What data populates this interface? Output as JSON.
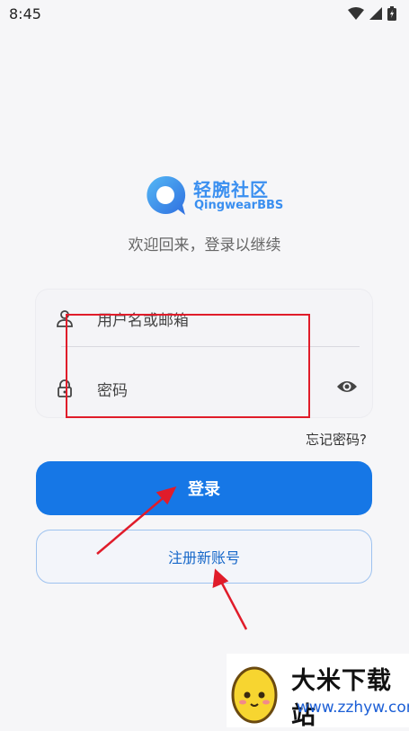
{
  "status": {
    "time": "8:45"
  },
  "app": {
    "logo_title": "轻腕社区",
    "logo_sub": "QingwearBBS",
    "subtitle": "欢迎回来，登录以继续"
  },
  "form": {
    "username_placeholder": "用户名或邮箱",
    "password_placeholder": "密码",
    "forgot_label": "忘记密码?",
    "login_label": "登录",
    "register_label": "注册新账号"
  },
  "watermark": {
    "title": "大米下载站",
    "url": "www.zzhyw.com"
  },
  "colors": {
    "primary": "#1677e6",
    "register_border": "#9ec2ef",
    "annotation": "#e01c2a"
  }
}
